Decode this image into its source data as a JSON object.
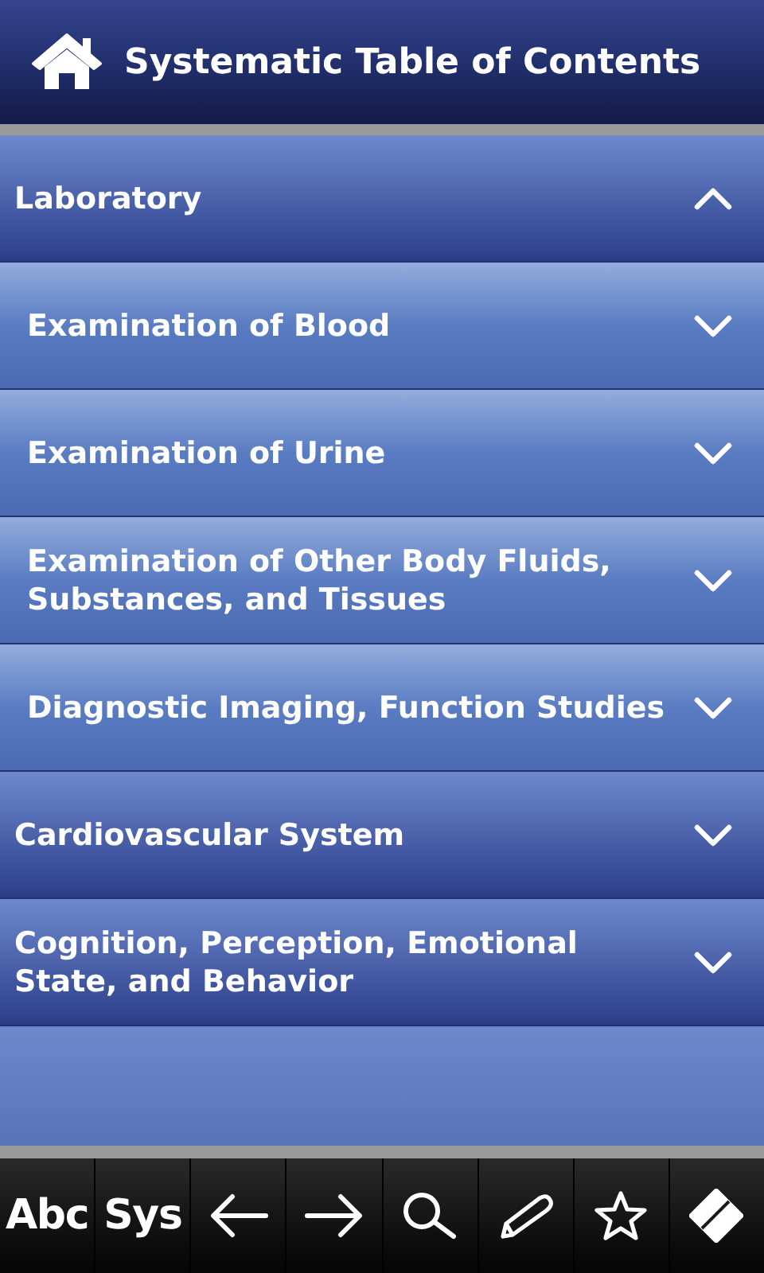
{
  "header": {
    "title": "Systematic Table of Contents"
  },
  "sections": [
    {
      "label": "Laboratory",
      "expanded": true,
      "children": [
        {
          "label": "Examination of Blood",
          "expanded": false
        },
        {
          "label": "Examination of Urine",
          "expanded": false
        },
        {
          "label": "Examination of Other Body Fluids, Substances, and Tissues",
          "expanded": false
        },
        {
          "label": "Diagnostic Imaging, Function Studies",
          "expanded": false
        }
      ]
    },
    {
      "label": "Cardiovascular System",
      "expanded": false
    },
    {
      "label": "Cognition, Perception, Emotional State, and Behavior",
      "expanded": false
    }
  ],
  "toolbar": [
    {
      "kind": "text",
      "label": "Abc"
    },
    {
      "kind": "text",
      "label": "Sys"
    },
    {
      "kind": "back"
    },
    {
      "kind": "forward"
    },
    {
      "kind": "search"
    },
    {
      "kind": "pencil"
    },
    {
      "kind": "star"
    },
    {
      "kind": "eraser"
    }
  ]
}
